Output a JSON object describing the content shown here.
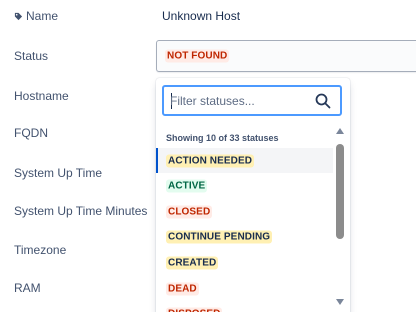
{
  "fields": {
    "name_label": "Name",
    "name_value": "Unknown Host",
    "status_label": "Status",
    "status_value": "NOT FOUND",
    "hostname_label": "Hostname",
    "fqdn_label": "FQDN",
    "uptime_label": "System Up Time",
    "uptime_minutes_label": "System Up Time Minutes",
    "timezone_label": "Timezone",
    "ram_label": "RAM"
  },
  "dropdown": {
    "search_placeholder": "Filter statuses...",
    "showing_text": "Showing 10 of 33 statuses",
    "options": [
      {
        "label": "ACTION NEEDED",
        "bg": "#fff0b3",
        "fg": "#172b4d"
      },
      {
        "label": "ACTIVE",
        "bg": "#e3fcef",
        "fg": "#006644"
      },
      {
        "label": "CLOSED",
        "bg": "#ffebe6",
        "fg": "#bf2600"
      },
      {
        "label": "CONTINUE PENDING",
        "bg": "#fff0b3",
        "fg": "#172b4d"
      },
      {
        "label": "CREATED",
        "bg": "#fff0b3",
        "fg": "#172b4d"
      },
      {
        "label": "DEAD",
        "bg": "#ffebe6",
        "fg": "#bf2600"
      },
      {
        "label": "DISPOSED",
        "bg": "#ffebe6",
        "fg": "#bf2600"
      }
    ]
  },
  "colors": {
    "focus_border": "#4c9aff",
    "selected_indicator": "#0052cc"
  },
  "icons": {
    "name_icon": "tag-icon",
    "search_icon": "search-icon"
  }
}
